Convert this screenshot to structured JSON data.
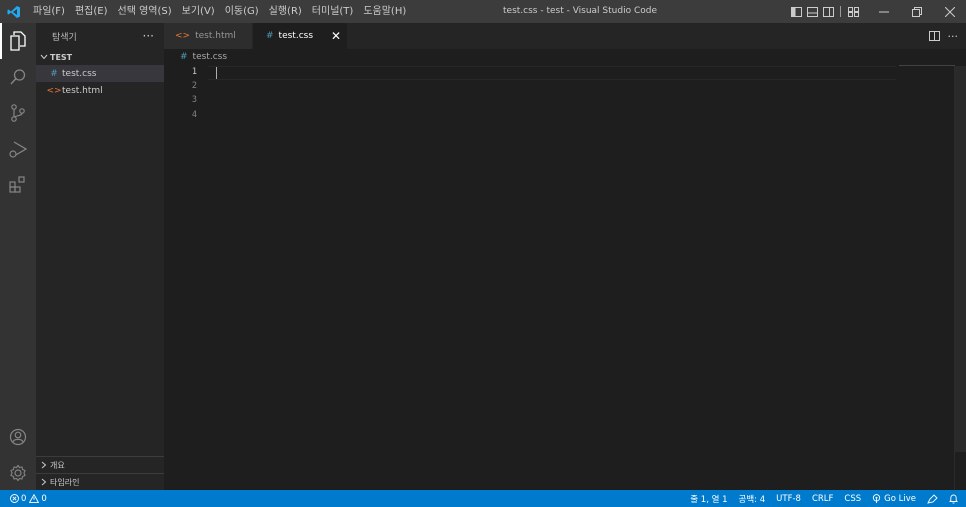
{
  "titlebar": {
    "menu": [
      "파일(F)",
      "편집(E)",
      "선택 영역(S)",
      "보기(V)",
      "이동(G)",
      "실행(R)",
      "터미널(T)",
      "도움말(H)"
    ],
    "window_title": "test.css - test - Visual Studio Code"
  },
  "sidebar": {
    "title": "탐색기",
    "more": "···",
    "folder": "TEST",
    "files": [
      {
        "name": "test.css",
        "icon": "#",
        "icon_color": "#519aba",
        "selected": true
      },
      {
        "name": "test.html",
        "icon": "<>",
        "icon_color": "#e37933",
        "selected": false
      }
    ],
    "sections": [
      "개요",
      "타임라인"
    ]
  },
  "tabs": [
    {
      "label": "test.html",
      "icon": "<>",
      "active": false
    },
    {
      "label": "test.css",
      "icon": "#",
      "active": true,
      "close": "✕"
    }
  ],
  "breadcrumb": {
    "icon": "#",
    "file": "test.css"
  },
  "editor": {
    "line_numbers": [
      "1",
      "2",
      "3",
      "4"
    ],
    "active_line": "1"
  },
  "statusbar": {
    "errors": "0",
    "warnings": "0",
    "position": "줄 1, 열 1",
    "spaces": "공백: 4",
    "encoding": "UTF-8",
    "eol": "CRLF",
    "language": "CSS",
    "golive": "Go Live"
  },
  "colors": {
    "accent": "#007acc",
    "titlebar": "#3c3c3c",
    "activitybar": "#333333",
    "sidebar": "#252526",
    "editor": "#1e1e1e"
  }
}
